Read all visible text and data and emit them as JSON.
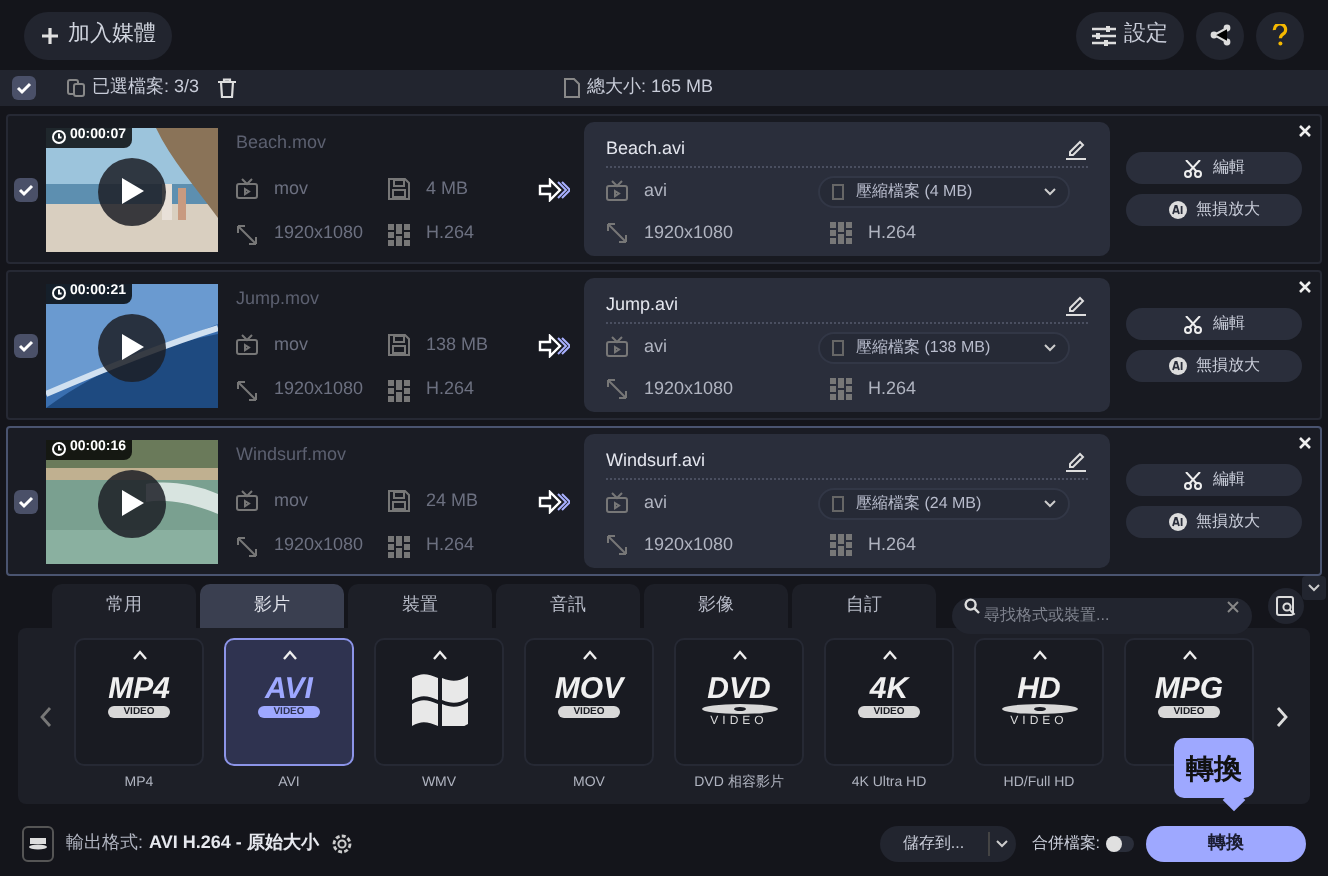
{
  "toolbar": {
    "add_button": "加入媒體",
    "settings_button": "設定"
  },
  "selection_bar": {
    "all_checked": true,
    "selected_label": "已選檔案: 3/3",
    "total_label": "總大小: 165 MB"
  },
  "files": [
    {
      "checked": true,
      "selected": false,
      "duration": "00:00:07",
      "name": "Beach.mov",
      "format": "mov",
      "size": "4 MB",
      "resolution": "1920x1080",
      "codec": "H.264",
      "output": {
        "name": "Beach.avi",
        "format": "avi",
        "compression": "壓縮檔案 (4 MB)",
        "resolution": "1920x1080",
        "codec": "H.264"
      },
      "edit_button": "編輯",
      "upscale_button": "無損放大"
    },
    {
      "checked": true,
      "selected": false,
      "duration": "00:00:21",
      "name": "Jump.mov",
      "format": "mov",
      "size": "138 MB",
      "resolution": "1920x1080",
      "codec": "H.264",
      "output": {
        "name": "Jump.avi",
        "format": "avi",
        "compression": "壓縮檔案 (138 MB)",
        "resolution": "1920x1080",
        "codec": "H.264"
      },
      "edit_button": "編輯",
      "upscale_button": "無損放大"
    },
    {
      "checked": true,
      "selected": true,
      "duration": "00:00:16",
      "name": "Windsurf.mov",
      "format": "mov",
      "size": "24 MB",
      "resolution": "1920x1080",
      "codec": "H.264",
      "output": {
        "name": "Windsurf.avi",
        "format": "avi",
        "compression": "壓縮檔案 (24 MB)",
        "resolution": "1920x1080",
        "codec": "H.264"
      },
      "edit_button": "編輯",
      "upscale_button": "無損放大"
    }
  ],
  "format_tabs": [
    {
      "label": "常用",
      "selected": false
    },
    {
      "label": "影片",
      "selected": true
    },
    {
      "label": "裝置",
      "selected": false
    },
    {
      "label": "音訊",
      "selected": false
    },
    {
      "label": "影像",
      "selected": false
    },
    {
      "label": "自訂",
      "selected": false
    }
  ],
  "format_search": {
    "placeholder": "尋找格式或裝置..."
  },
  "formats": [
    {
      "kind": "logo",
      "logo": "MP4",
      "sub": "VIDEO",
      "label": "MP4",
      "selected": false
    },
    {
      "kind": "logo",
      "logo": "AVI",
      "sub": "VIDEO",
      "label": "AVI",
      "selected": true
    },
    {
      "kind": "windows",
      "label": "WMV",
      "selected": false
    },
    {
      "kind": "logo",
      "logo": "MOV",
      "sub": "VIDEO",
      "label": "MOV",
      "selected": false
    },
    {
      "kind": "disc",
      "logo": "DVD",
      "sub": "VIDEO",
      "label": "DVD 相容影片",
      "selected": false
    },
    {
      "kind": "logo",
      "logo": "4K",
      "sub": "VIDEO",
      "label": "4K Ultra HD",
      "selected": false
    },
    {
      "kind": "disc",
      "logo": "HD",
      "sub": "VIDEO",
      "label": "HD/Full HD",
      "selected": false
    },
    {
      "kind": "logo",
      "logo": "MPG",
      "sub": "VIDEO",
      "selected": false
    }
  ],
  "bottom_bar": {
    "output_label": "輸出格式:",
    "output_value": "AVI H.264 - 原始大小",
    "save_button": "儲存到...",
    "merge_label": "合併檔案:",
    "merge_on": false,
    "convert_button": "轉換"
  },
  "tooltip": "轉換"
}
